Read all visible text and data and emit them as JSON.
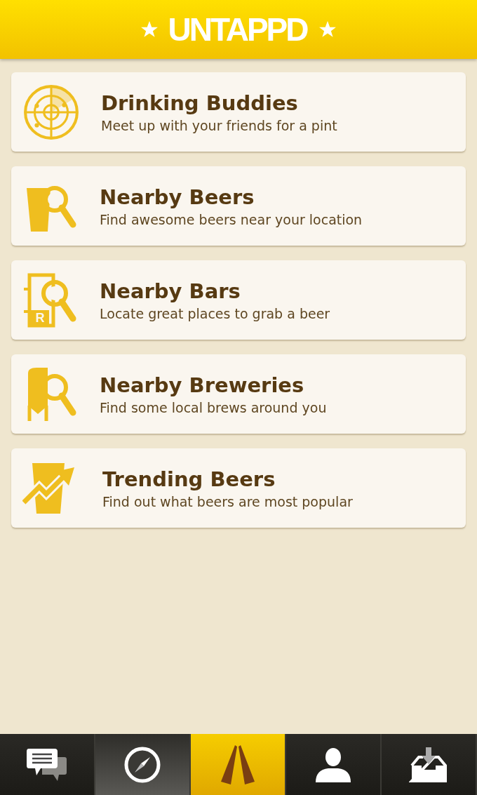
{
  "header": {
    "title": "UNTAPPD"
  },
  "menu": [
    {
      "kind": "radar",
      "title": "Drinking Buddies",
      "subtitle": "Meet up with your friends for a pint"
    },
    {
      "kind": "beer",
      "title": "Nearby Beers",
      "subtitle": "Find awesome beers near your location"
    },
    {
      "kind": "bar",
      "title": "Nearby Bars",
      "subtitle": "Locate great places to grab a beer"
    },
    {
      "kind": "brewery",
      "title": "Nearby Breweries",
      "subtitle": "Find some local brews around you"
    },
    {
      "kind": "trending",
      "title": "Trending Beers",
      "subtitle": "Find out what beers are most popular"
    }
  ],
  "tab_bar": [
    {
      "kind": "chat",
      "selected": false
    },
    {
      "kind": "compass",
      "selected": true
    },
    {
      "kind": "checkin",
      "selected": false
    },
    {
      "kind": "profile",
      "selected": false
    },
    {
      "kind": "inbox",
      "selected": false
    }
  ],
  "bar_sign_letter": "R"
}
